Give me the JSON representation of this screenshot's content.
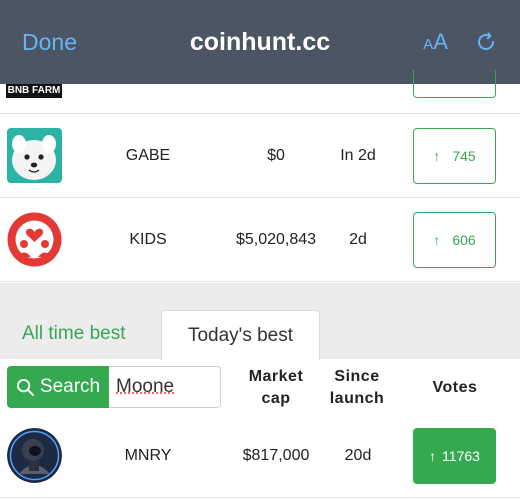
{
  "browser": {
    "done_label": "Done",
    "site": "coinhunt.cc",
    "text_size_label_small": "A",
    "text_size_label_large": "A",
    "accent_color": "#64b5f6"
  },
  "partial_row": {
    "logo_text": "BNB FARM"
  },
  "rows": [
    {
      "symbol": "GABE",
      "market_cap": "$0",
      "launch": "In 2d",
      "votes": "745",
      "logo": "dog-avatar"
    },
    {
      "symbol": "KIDS",
      "market_cap": "$5,020,843",
      "launch": "2d",
      "votes": "606",
      "logo": "red-heart-people-logo"
    }
  ],
  "tabs": {
    "all_time": "All time best",
    "today": "Today's best"
  },
  "search": {
    "button_label": "Search",
    "value": "Moone"
  },
  "columns": {
    "market_cap": [
      "Market",
      "cap"
    ],
    "since_launch": [
      "Since",
      "launch"
    ],
    "votes": "Votes"
  },
  "today_rows": [
    {
      "symbol": "MNRY",
      "market_cap": "$817,000",
      "launch": "20d",
      "votes": "11763",
      "logo": "astronaut-avatar"
    }
  ],
  "colors": {
    "green": "#35a94f",
    "topbar": "#4b5563"
  }
}
